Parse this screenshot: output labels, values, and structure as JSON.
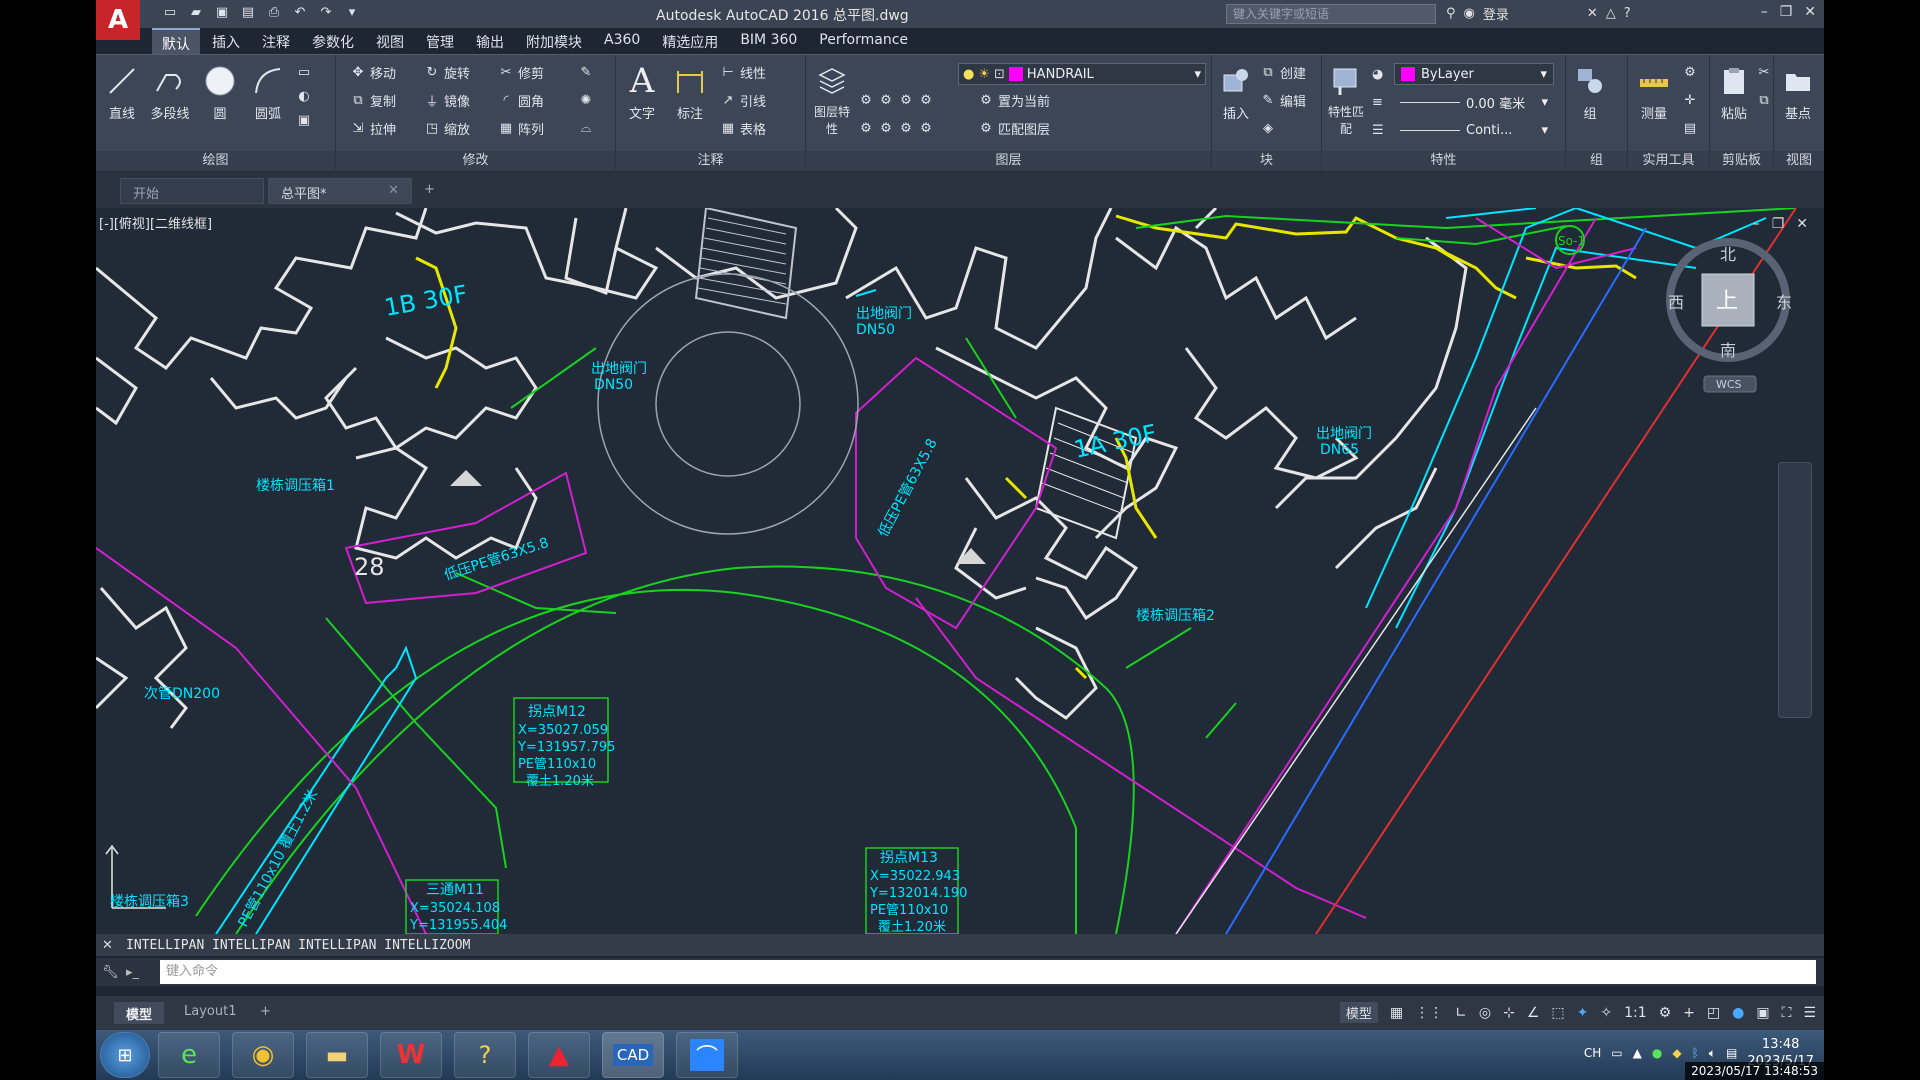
{
  "titlebar": {
    "logo": "A",
    "title": "Autodesk AutoCAD 2016    总平图.dwg",
    "search_placeholder": "键入关键字或短语",
    "login": "登录"
  },
  "ribbon_tabs": [
    "默认",
    "插入",
    "注释",
    "参数化",
    "视图",
    "管理",
    "输出",
    "附加模块",
    "A360",
    "精选应用",
    "BIM 360",
    "Performance"
  ],
  "ribbon": {
    "draw": {
      "line": "直线",
      "polyline": "多段线",
      "circle": "圆",
      "arc": "圆弧",
      "title": "绘图"
    },
    "modify": {
      "move": "移动",
      "rotate": "旋转",
      "trim": "修剪",
      "copy": "复制",
      "mirror": "镜像",
      "fillet": "圆角",
      "stretch": "拉伸",
      "scale": "缩放",
      "array": "阵列",
      "title": "修改"
    },
    "annotation": {
      "text": "文字",
      "dimension": "标注",
      "linear": "线性",
      "leader": "引线",
      "table": "表格",
      "title": "注释"
    },
    "layers": {
      "layer_props": "图层特性",
      "current_layer": "HANDRAIL",
      "set_current": "置为当前",
      "match_layer": "匹配图层",
      "title": "图层"
    },
    "block": {
      "insert": "插入",
      "create": "创建",
      "edit": "编辑",
      "title": "块"
    },
    "properties": {
      "match": "特性匹配",
      "color": "ByLayer",
      "lineweight": "0.00 毫米",
      "linetype": "Conti...",
      "title": "特性"
    },
    "groups": {
      "group": "组",
      "title": "组"
    },
    "utilities": {
      "measure": "测量",
      "title": "实用工具"
    },
    "clipboard": {
      "paste": "粘贴",
      "title": "剪贴板"
    },
    "view": {
      "base": "基点",
      "title": "视图"
    }
  },
  "doc_tabs": {
    "start": "开始",
    "current": "总平图*"
  },
  "viewport": {
    "label": "[-][俯视][二维线框]",
    "viewcube": {
      "north": "北",
      "south": "南",
      "east": "东",
      "west": "西",
      "top": "上",
      "wcs": "WCS"
    },
    "annotations": {
      "valve1_a": "出地阀门",
      "valve1_b": "DN50",
      "valve2_a": "出地阀门",
      "valve2_b": "DN50",
      "valve3_a": "出地阀门",
      "valve3_b": "DN65",
      "regbox1": "楼栋调压箱2",
      "regbox2": "楼栋调压箱1",
      "regbox3": "楼栋调压箱3",
      "pipe1": "低压PE管63X5.8",
      "pipe2": "低压PE管63X5.8",
      "pipe_dn200": "次管DN200",
      "pipe_diag": "PE管110x10 覆土1.2米",
      "building1": "1B 30F",
      "building2": "1A 30F",
      "num28": "28",
      "point_so1": "So-1",
      "pt12": {
        "title": "拐点M12",
        "x": "X=35027.059",
        "y": "Y=131957.795",
        "pipe": "PE管110x10",
        "depth": "覆土1.20米"
      },
      "pt13": {
        "title": "拐点M13",
        "x": "X=35022.943",
        "y": "Y=132014.190",
        "pipe": "PE管110x10",
        "depth": "覆土1.20米"
      },
      "pt11": {
        "title": "三通M11",
        "x": "X=35024.108",
        "y": "Y=131955.404"
      }
    }
  },
  "command": {
    "history": "INTELLIPAN INTELLIPAN INTELLIPAN INTELLIZOOM",
    "placeholder": "键入命令"
  },
  "layout_tabs": [
    "模型",
    "Layout1"
  ],
  "status": {
    "model": "模型",
    "scale": "1:1"
  },
  "tray": {
    "lang": "CH",
    "time": "13:48",
    "date": "2023/5/17"
  },
  "stamp": "2023/05/17 13:48:53",
  "colors": {
    "background": "#212a37",
    "cyan": "#00ffff",
    "green": "#19d21f",
    "magenta": "#d020d0",
    "yellow": "#e6e600",
    "white": "#e6e6e6",
    "blue": "#2a6cff",
    "red": "#e03030"
  }
}
